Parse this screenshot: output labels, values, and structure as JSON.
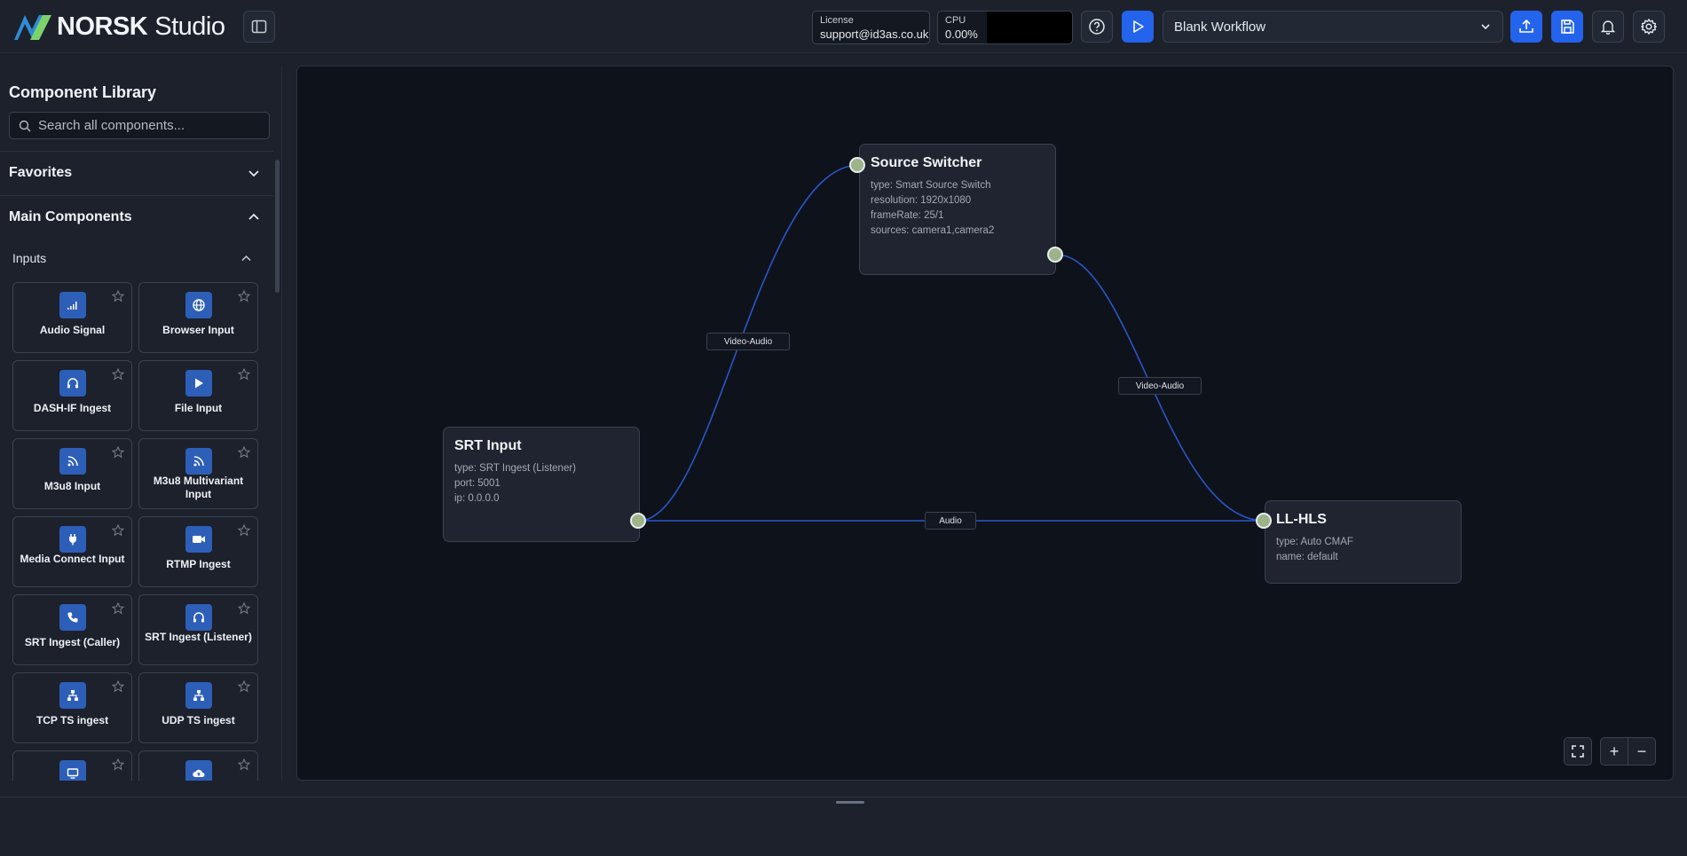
{
  "app": {
    "brand": "NORSK",
    "product": "Studio"
  },
  "header": {
    "license_label": "License",
    "license_value": "support@id3as.co.uk",
    "cpu_label": "CPU",
    "cpu_value": "0.00%",
    "workflow_select": "Blank Workflow"
  },
  "sidebar": {
    "title": "Component Library",
    "search_placeholder": "Search all components...",
    "favorites": "Favorites",
    "main_components": "Main Components",
    "inputs": "Inputs",
    "cards": [
      {
        "label": "Audio Signal",
        "icon": "audio-signal-icon"
      },
      {
        "label": "Browser Input",
        "icon": "globe-icon"
      },
      {
        "label": "DASH-IF Ingest",
        "icon": "headphones-icon"
      },
      {
        "label": "File Input",
        "icon": "play-icon"
      },
      {
        "label": "M3u8 Input",
        "icon": "rss-icon"
      },
      {
        "label": "M3u8 Multivariant Input",
        "icon": "rss-icon"
      },
      {
        "label": "Media Connect Input",
        "icon": "plug-icon"
      },
      {
        "label": "RTMP Ingest",
        "icon": "video-camera-icon"
      },
      {
        "label": "SRT Ingest (Caller)",
        "icon": "phone-icon"
      },
      {
        "label": "SRT Ingest (Listener)",
        "icon": "headphones-icon"
      },
      {
        "label": "TCP TS ingest",
        "icon": "network-icon"
      },
      {
        "label": "UDP TS ingest",
        "icon": "network-icon"
      },
      {
        "label": "",
        "icon": "monitor-icon"
      },
      {
        "label": "",
        "icon": "cloud-upload-icon"
      }
    ]
  },
  "canvas": {
    "nodes": {
      "source_switcher": {
        "title": "Source Switcher",
        "lines": [
          "type: Smart Source Switch",
          "resolution: 1920x1080",
          "frameRate: 25/1",
          "sources: camera1,camera2"
        ]
      },
      "srt_input": {
        "title": "SRT Input",
        "lines": [
          "type: SRT Ingest (Listener)",
          "port: 5001",
          "ip: 0.0.0.0"
        ]
      },
      "ll_hls": {
        "title": "LL-HLS",
        "lines": [
          "type: Auto CMAF",
          "name: default"
        ]
      }
    },
    "edges": {
      "srt_to_switcher": "Video-Audio",
      "switcher_to_hls": "Video-Audio",
      "srt_to_hls": "Audio"
    },
    "zoom_in": "+",
    "zoom_out": "−"
  },
  "colors": {
    "accent": "#2463eb",
    "port": "#9db38a",
    "edge": "#2a56c6",
    "canvas_bg": "#0e121b"
  }
}
